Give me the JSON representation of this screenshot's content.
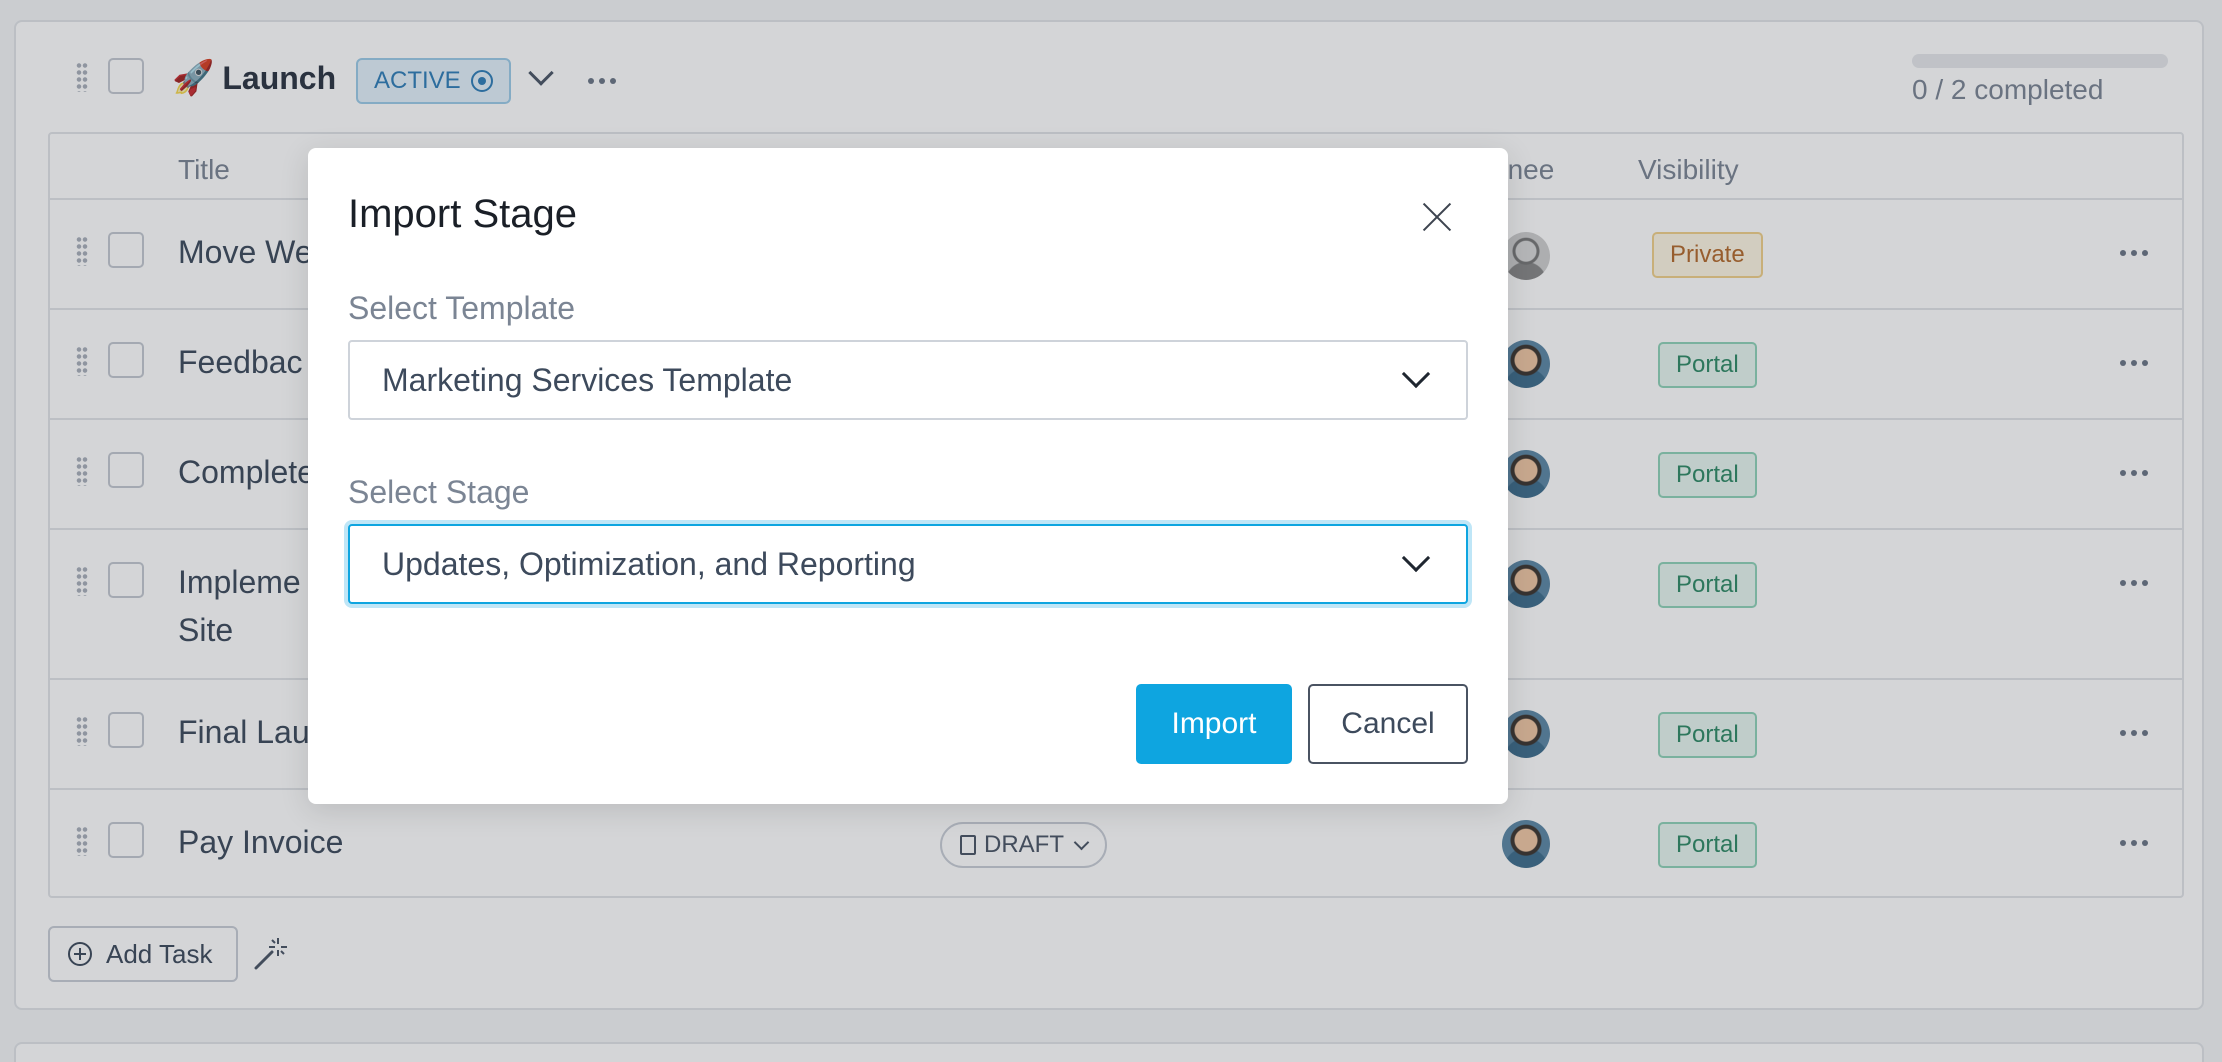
{
  "stage": {
    "emoji": "🚀",
    "title": "Launch",
    "status": "ACTIVE",
    "progress": {
      "completed": 0,
      "total": 2,
      "fraction": 0,
      "text": "0 / 2 completed"
    }
  },
  "table": {
    "columns": {
      "title": "Title",
      "assignee": "gnee",
      "visibility": "Visibility"
    },
    "rows": [
      {
        "title": "Move We",
        "assignee": "gray-avatar",
        "visibility": "Private"
      },
      {
        "title": "Feedbac",
        "assignee": "avatar",
        "visibility": "Portal"
      },
      {
        "title": "Complete",
        "assignee": "avatar",
        "visibility": "Portal"
      },
      {
        "title_line1": "Impleme",
        "title_line2": "Site",
        "assignee": "avatar",
        "visibility": "Portal"
      },
      {
        "title": "Final Lau",
        "assignee": "avatar",
        "visibility": "Portal"
      },
      {
        "title": "Pay Invoice",
        "status": "DRAFT",
        "assignee": "avatar",
        "visibility": "Portal"
      }
    ]
  },
  "footer": {
    "add_task": "Add Task"
  },
  "modal": {
    "title": "Import Stage",
    "template_label": "Select Template",
    "template_value": "Marketing Services Template",
    "stage_label": "Select Stage",
    "stage_value": "Updates, Optimization, and Reporting",
    "import_button": "Import",
    "cancel_button": "Cancel"
  },
  "colors": {
    "accent": "#0ea5e0",
    "active_badge": "#2f7eb8",
    "private_badge": "#b36a2c",
    "portal_badge": "#2f8a66"
  }
}
